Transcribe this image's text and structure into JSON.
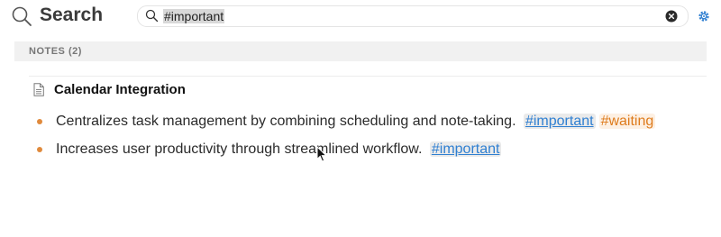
{
  "header": {
    "title": "Search",
    "title_icon": "magnifier-icon",
    "search": {
      "value": "#important",
      "placeholder": "",
      "search_icon": "search-icon",
      "clear_icon": "clear-circle-icon"
    },
    "settings_icon": "gear-icon"
  },
  "results": {
    "section_label": "NOTES (2)",
    "notes": [
      {
        "icon": "document-icon",
        "title": "Calendar Integration",
        "bullets": [
          {
            "text": "Centralizes task management by combining scheduling and note-taking.",
            "tags": [
              "#important",
              "#waiting"
            ]
          },
          {
            "text": "Increases user productivity through streamlined workflow.",
            "tags": [
              "#important "
            ]
          }
        ]
      }
    ]
  },
  "colors": {
    "bullet_dot": "#e08a3c",
    "tag_important": "#2f7fd1",
    "tag_waiting": "#de7b1c",
    "settings_icon": "#2f7fd1"
  }
}
